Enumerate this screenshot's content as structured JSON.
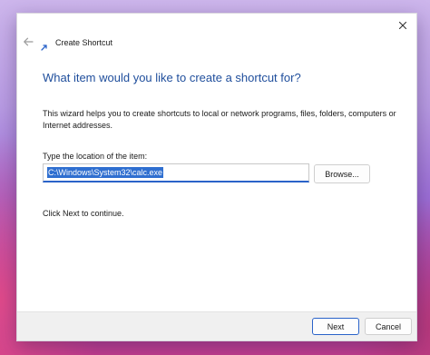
{
  "window": {
    "title": "Create Shortcut"
  },
  "icons": {
    "back": "back-arrow-icon",
    "app": "shortcut-icon",
    "close": "close-icon"
  },
  "wizard": {
    "heading": "What item would you like to create a shortcut for?",
    "description": "This wizard helps you to create shortcuts to local or network programs, files, folders, computers or Internet addresses.",
    "location_label": "Type the location of the item:",
    "location_value": "C:\\Windows\\System32\\calc.exe",
    "browse_label": "Browse...",
    "hint": "Click Next to continue."
  },
  "footer": {
    "next_label": "Next",
    "cancel_label": "Cancel"
  },
  "colors": {
    "heading": "#1f4e9c",
    "accent": "#2a63c9",
    "selection": "#2f6fd0"
  }
}
